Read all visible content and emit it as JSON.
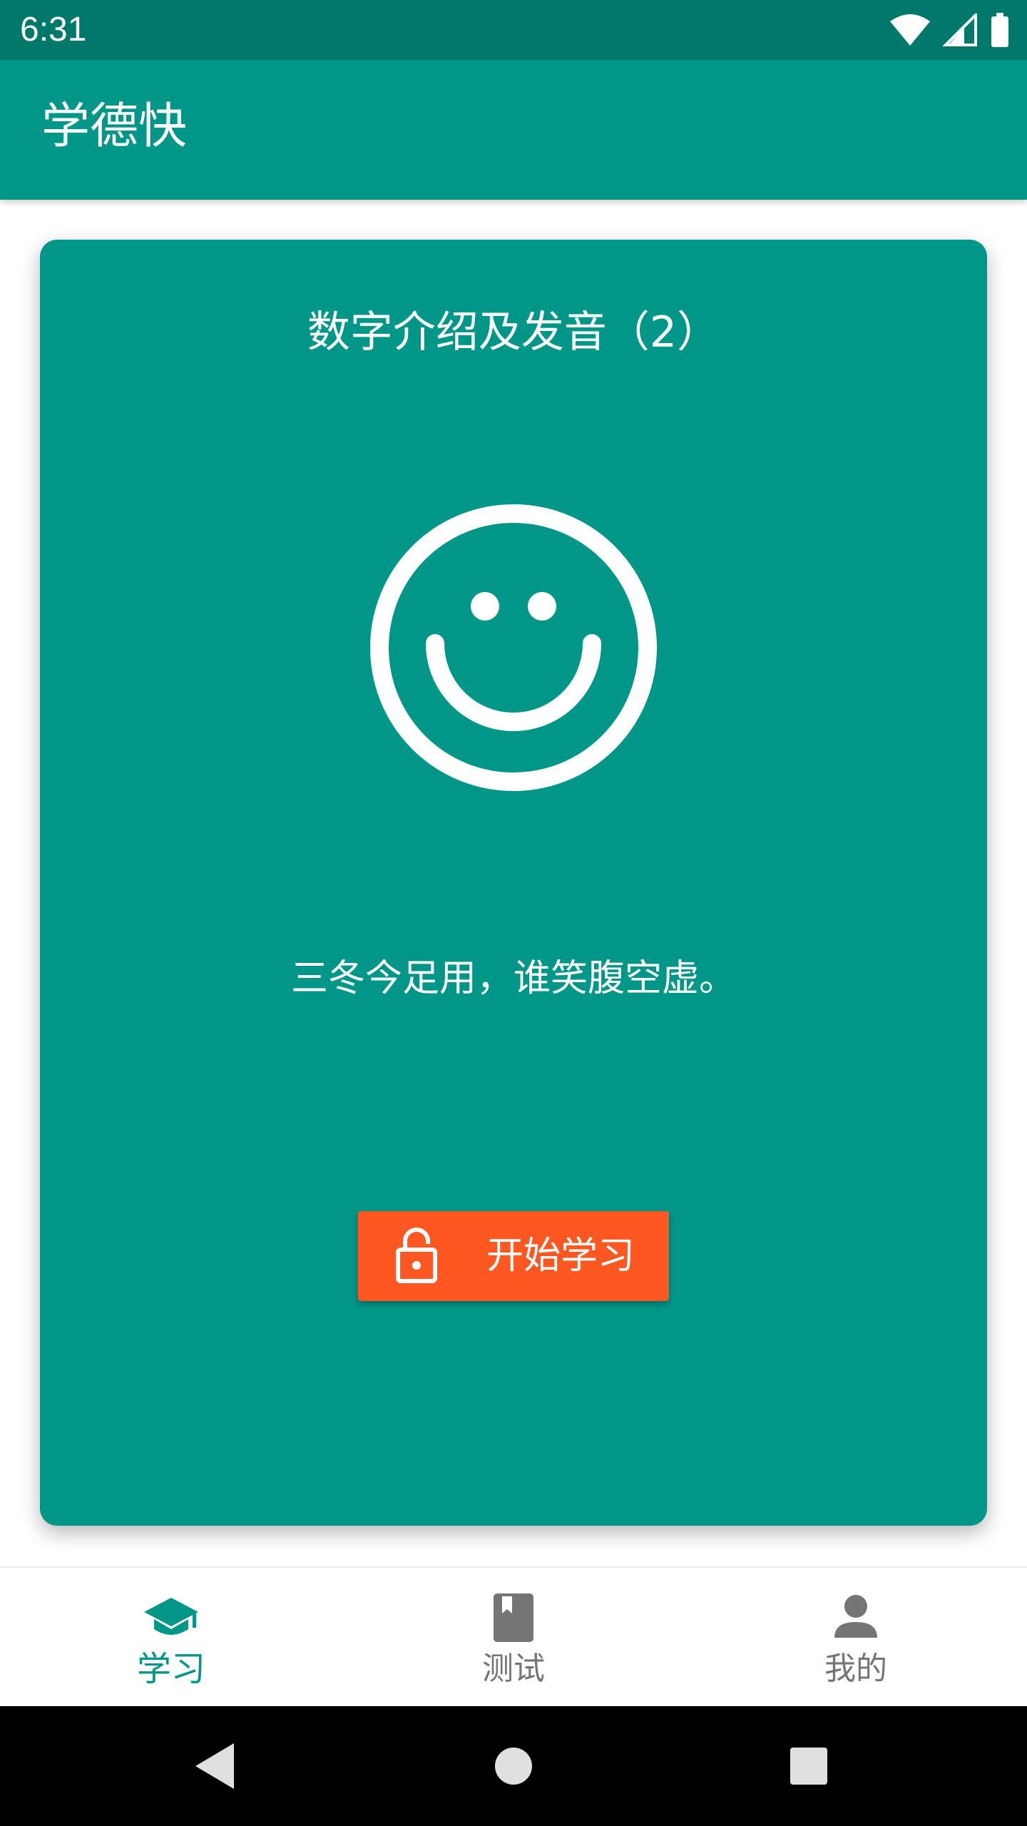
{
  "status_bar": {
    "time": "6:31",
    "icons": [
      "wifi-icon",
      "cell-signal-icon",
      "battery-icon"
    ]
  },
  "app_bar": {
    "title": "学德快"
  },
  "card": {
    "title": "数字介绍及发音（2）",
    "illustration": "smiley-face-icon",
    "text": "三冬今足用，谁笑腹空虚。",
    "start_button": {
      "icon": "lock-open-icon",
      "label": "开始学习"
    }
  },
  "bottom_nav": {
    "items": [
      {
        "label": "学习",
        "icon": "graduation-cap-icon",
        "active": true
      },
      {
        "label": "测试",
        "icon": "book-icon",
        "active": false
      },
      {
        "label": "我的",
        "icon": "person-icon",
        "active": false
      }
    ]
  },
  "system_nav": {
    "buttons": [
      "back-triangle-icon",
      "home-circle-icon",
      "recents-square-icon"
    ]
  },
  "colors": {
    "status_bar": "#00796b",
    "primary": "#009688",
    "accent": "#ff5722",
    "inactive": "#757575"
  }
}
